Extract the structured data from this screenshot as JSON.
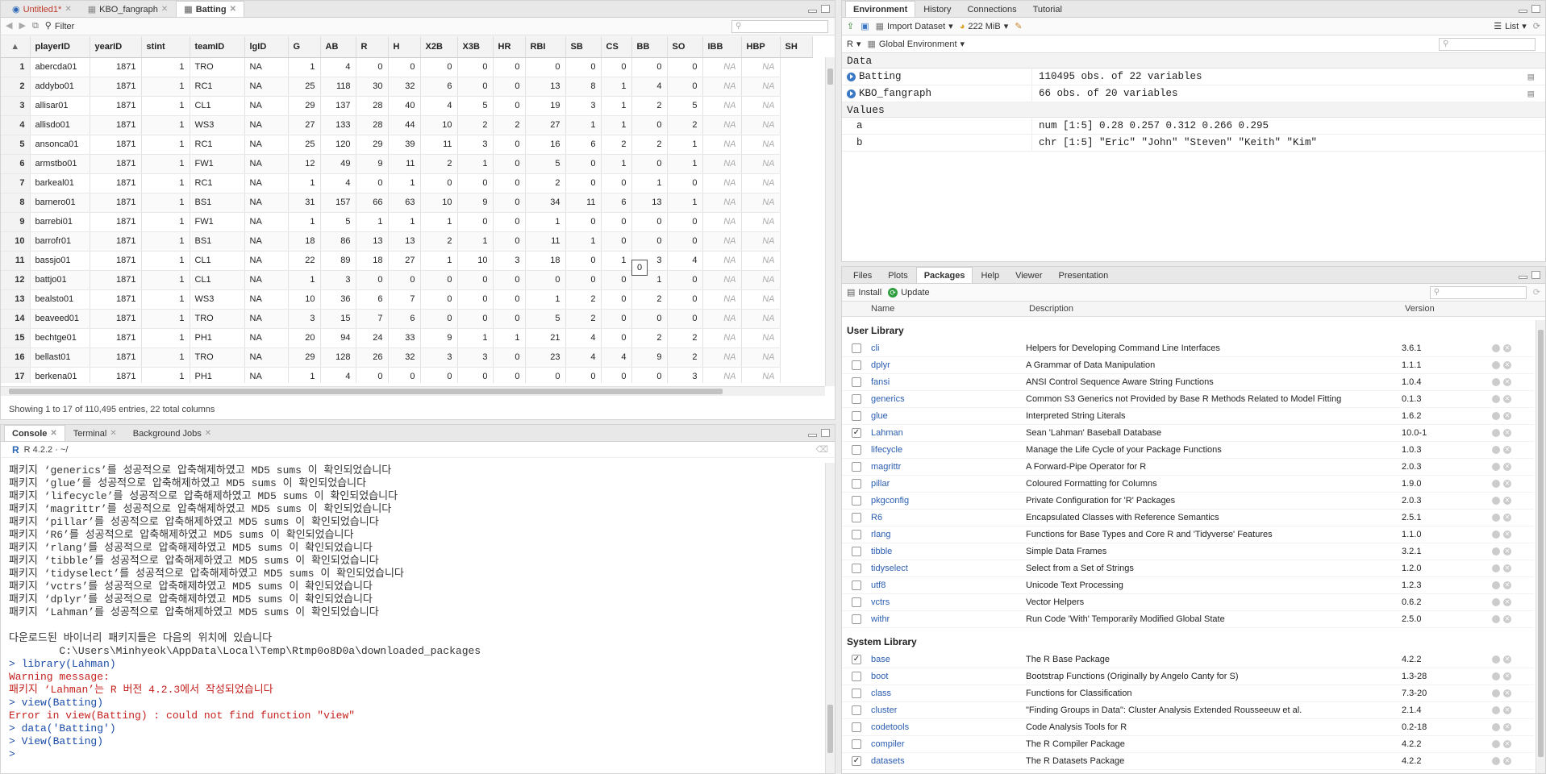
{
  "source_pane": {
    "tabs": [
      {
        "label": "Untitled1*",
        "icon": "r-script-icon"
      },
      {
        "label": "KBO_fangraph",
        "icon": "table-icon"
      },
      {
        "label": "Batting",
        "icon": "table-icon"
      }
    ],
    "filter_label": "Filter",
    "columns": [
      "playerID",
      "yearID",
      "stint",
      "teamID",
      "lgID",
      "G",
      "AB",
      "R",
      "H",
      "X2B",
      "X3B",
      "HR",
      "RBI",
      "SB",
      "CS",
      "BB",
      "SO",
      "IBB",
      "HBP",
      "SH"
    ],
    "rows": [
      [
        "1",
        "abercda01",
        "1871",
        "1",
        "TRO",
        "NA",
        "1",
        "4",
        "0",
        "0",
        "0",
        "0",
        "0",
        "0",
        "0",
        "0",
        "0",
        "0",
        "NA",
        "NA"
      ],
      [
        "2",
        "addybo01",
        "1871",
        "1",
        "RC1",
        "NA",
        "25",
        "118",
        "30",
        "32",
        "6",
        "0",
        "0",
        "13",
        "8",
        "1",
        "4",
        "0",
        "NA",
        "NA"
      ],
      [
        "3",
        "allisar01",
        "1871",
        "1",
        "CL1",
        "NA",
        "29",
        "137",
        "28",
        "40",
        "4",
        "5",
        "0",
        "19",
        "3",
        "1",
        "2",
        "5",
        "NA",
        "NA"
      ],
      [
        "4",
        "allisdo01",
        "1871",
        "1",
        "WS3",
        "NA",
        "27",
        "133",
        "28",
        "44",
        "10",
        "2",
        "2",
        "27",
        "1",
        "1",
        "0",
        "2",
        "NA",
        "NA"
      ],
      [
        "5",
        "ansonca01",
        "1871",
        "1",
        "RC1",
        "NA",
        "25",
        "120",
        "29",
        "39",
        "11",
        "3",
        "0",
        "16",
        "6",
        "2",
        "2",
        "1",
        "NA",
        "NA"
      ],
      [
        "6",
        "armstbo01",
        "1871",
        "1",
        "FW1",
        "NA",
        "12",
        "49",
        "9",
        "11",
        "2",
        "1",
        "0",
        "5",
        "0",
        "1",
        "0",
        "1",
        "NA",
        "NA"
      ],
      [
        "7",
        "barkeal01",
        "1871",
        "1",
        "RC1",
        "NA",
        "1",
        "4",
        "0",
        "1",
        "0",
        "0",
        "0",
        "2",
        "0",
        "0",
        "1",
        "0",
        "NA",
        "NA"
      ],
      [
        "8",
        "barnero01",
        "1871",
        "1",
        "BS1",
        "NA",
        "31",
        "157",
        "66",
        "63",
        "10",
        "9",
        "0",
        "34",
        "11",
        "6",
        "13",
        "1",
        "NA",
        "NA"
      ],
      [
        "9",
        "barrebi01",
        "1871",
        "1",
        "FW1",
        "NA",
        "1",
        "5",
        "1",
        "1",
        "1",
        "0",
        "0",
        "1",
        "0",
        "0",
        "0",
        "0",
        "NA",
        "NA"
      ],
      [
        "10",
        "barrofr01",
        "1871",
        "1",
        "BS1",
        "NA",
        "18",
        "86",
        "13",
        "13",
        "2",
        "1",
        "0",
        "11",
        "1",
        "0",
        "0",
        "0",
        "NA",
        "NA"
      ],
      [
        "11",
        "bassjo01",
        "1871",
        "1",
        "CL1",
        "NA",
        "22",
        "89",
        "18",
        "27",
        "1",
        "10",
        "3",
        "18",
        "0",
        "1",
        "3",
        "4",
        "NA",
        "NA"
      ],
      [
        "12",
        "battjo01",
        "1871",
        "1",
        "CL1",
        "NA",
        "1",
        "3",
        "0",
        "0",
        "0",
        "0",
        "0",
        "0",
        "0",
        "0",
        "1",
        "0",
        "NA",
        "NA"
      ],
      [
        "13",
        "bealsto01",
        "1871",
        "1",
        "WS3",
        "NA",
        "10",
        "36",
        "6",
        "7",
        "0",
        "0",
        "0",
        "1",
        "2",
        "0",
        "2",
        "0",
        "NA",
        "NA"
      ],
      [
        "14",
        "beaveed01",
        "1871",
        "1",
        "TRO",
        "NA",
        "3",
        "15",
        "7",
        "6",
        "0",
        "0",
        "0",
        "5",
        "2",
        "0",
        "0",
        "0",
        "NA",
        "NA"
      ],
      [
        "15",
        "bechtge01",
        "1871",
        "1",
        "PH1",
        "NA",
        "20",
        "94",
        "24",
        "33",
        "9",
        "1",
        "1",
        "21",
        "4",
        "0",
        "2",
        "2",
        "NA",
        "NA"
      ],
      [
        "16",
        "bellast01",
        "1871",
        "1",
        "TRO",
        "NA",
        "29",
        "128",
        "26",
        "32",
        "3",
        "3",
        "0",
        "23",
        "4",
        "4",
        "9",
        "2",
        "NA",
        "NA"
      ],
      [
        "17",
        "berkena01",
        "1871",
        "1",
        "PH1",
        "NA",
        "1",
        "4",
        "0",
        "0",
        "0",
        "0",
        "0",
        "0",
        "0",
        "0",
        "0",
        "3",
        "NA",
        "NA"
      ]
    ],
    "tooltip_value": "0",
    "status": "Showing 1 to 17 of 110,495 entries, 22 total columns"
  },
  "console_pane": {
    "tabs": [
      "Console",
      "Terminal",
      "Background Jobs"
    ],
    "version_path": "R 4.2.2 · ~/",
    "lines": [
      {
        "t": "패키지 ‘generics’를 성공적으로 압축해제하였고 MD5 sums 이 확인되었습니다",
        "c": ""
      },
      {
        "t": "패키지 ‘glue’를 성공적으로 압축해제하였고 MD5 sums 이 확인되었습니다",
        "c": ""
      },
      {
        "t": "패키지 ‘lifecycle’를 성공적으로 압축해제하였고 MD5 sums 이 확인되었습니다",
        "c": ""
      },
      {
        "t": "패키지 ‘magrittr’를 성공적으로 압축해제하였고 MD5 sums 이 확인되었습니다",
        "c": ""
      },
      {
        "t": "패키지 ‘pillar’를 성공적으로 압축해제하였고 MD5 sums 이 확인되었습니다",
        "c": ""
      },
      {
        "t": "패키지 ‘R6’를 성공적으로 압축해제하였고 MD5 sums 이 확인되었습니다",
        "c": ""
      },
      {
        "t": "패키지 ‘rlang’를 성공적으로 압축해제하였고 MD5 sums 이 확인되었습니다",
        "c": ""
      },
      {
        "t": "패키지 ‘tibble’를 성공적으로 압축해제하였고 MD5 sums 이 확인되었습니다",
        "c": ""
      },
      {
        "t": "패키지 ‘tidyselect’를 성공적으로 압축해제하였고 MD5 sums 이 확인되었습니다",
        "c": ""
      },
      {
        "t": "패키지 ‘vctrs’를 성공적으로 압축해제하였고 MD5 sums 이 확인되었습니다",
        "c": ""
      },
      {
        "t": "패키지 ‘dplyr’를 성공적으로 압축해제하였고 MD5 sums 이 확인되었습니다",
        "c": ""
      },
      {
        "t": "패키지 ‘Lahman’를 성공적으로 압축해제하였고 MD5 sums 이 확인되었습니다",
        "c": ""
      },
      {
        "t": " ",
        "c": ""
      },
      {
        "t": "다운로드된 바이너리 패키지들은 다음의 위치에 있습니다",
        "c": ""
      },
      {
        "t": "        C:\\Users\\Minhyeok\\AppData\\Local\\Temp\\Rtmp0o8D0a\\downloaded_packages",
        "c": ""
      },
      {
        "t": "> library(Lahman)",
        "c": "cmd"
      },
      {
        "t": "Warning message:",
        "c": "err"
      },
      {
        "t": "패키지 ‘Lahman’는 R 버전 4.2.3에서 작성되었습니다",
        "c": "err"
      },
      {
        "t": "> view(Batting)",
        "c": "cmd"
      },
      {
        "t": "Error in view(Batting) : could not find function \"view\"",
        "c": "err"
      },
      {
        "t": "> data('Batting')",
        "c": "cmd"
      },
      {
        "t": "> View(Batting)",
        "c": "cmd"
      },
      {
        "t": "> ",
        "c": "cmd"
      }
    ]
  },
  "env_pane": {
    "tabs": [
      "Environment",
      "History",
      "Connections",
      "Tutorial"
    ],
    "import_label": "Import Dataset",
    "memory": "222 MiB",
    "view_mode": "List",
    "lang": "R",
    "scope": "Global Environment",
    "data_header": "Data",
    "values_header": "Values",
    "data_items": [
      {
        "name": "Batting",
        "value": "110495 obs. of 22 variables"
      },
      {
        "name": "KBO_fangraph",
        "value": "66 obs. of 20 variables"
      }
    ],
    "value_items": [
      {
        "name": "a",
        "value": "num [1:5] 0.28 0.257 0.312 0.266 0.295"
      },
      {
        "name": "b",
        "value": "chr [1:5] \"Eric\" \"John\" \"Steven\" \"Keith\" \"Kim\""
      }
    ]
  },
  "files_pane": {
    "tabs": [
      "Files",
      "Plots",
      "Packages",
      "Help",
      "Viewer",
      "Presentation"
    ],
    "install_label": "Install",
    "update_label": "Update",
    "col_name": "Name",
    "col_desc": "Description",
    "col_version": "Version",
    "user_library": "User Library",
    "system_library": "System Library",
    "user_packages": [
      {
        "n": "cli",
        "d": "Helpers for Developing Command Line Interfaces",
        "v": "3.6.1",
        "c": false
      },
      {
        "n": "dplyr",
        "d": "A Grammar of Data Manipulation",
        "v": "1.1.1",
        "c": false
      },
      {
        "n": "fansi",
        "d": "ANSI Control Sequence Aware String Functions",
        "v": "1.0.4",
        "c": false
      },
      {
        "n": "generics",
        "d": "Common S3 Generics not Provided by Base R Methods Related to Model Fitting",
        "v": "0.1.3",
        "c": false
      },
      {
        "n": "glue",
        "d": "Interpreted String Literals",
        "v": "1.6.2",
        "c": false
      },
      {
        "n": "Lahman",
        "d": "Sean 'Lahman' Baseball Database",
        "v": "10.0-1",
        "c": true
      },
      {
        "n": "lifecycle",
        "d": "Manage the Life Cycle of your Package Functions",
        "v": "1.0.3",
        "c": false
      },
      {
        "n": "magrittr",
        "d": "A Forward-Pipe Operator for R",
        "v": "2.0.3",
        "c": false
      },
      {
        "n": "pillar",
        "d": "Coloured Formatting for Columns",
        "v": "1.9.0",
        "c": false
      },
      {
        "n": "pkgconfig",
        "d": "Private Configuration for 'R' Packages",
        "v": "2.0.3",
        "c": false
      },
      {
        "n": "R6",
        "d": "Encapsulated Classes with Reference Semantics",
        "v": "2.5.1",
        "c": false
      },
      {
        "n": "rlang",
        "d": "Functions for Base Types and Core R and 'Tidyverse' Features",
        "v": "1.1.0",
        "c": false
      },
      {
        "n": "tibble",
        "d": "Simple Data Frames",
        "v": "3.2.1",
        "c": false
      },
      {
        "n": "tidyselect",
        "d": "Select from a Set of Strings",
        "v": "1.2.0",
        "c": false
      },
      {
        "n": "utf8",
        "d": "Unicode Text Processing",
        "v": "1.2.3",
        "c": false
      },
      {
        "n": "vctrs",
        "d": "Vector Helpers",
        "v": "0.6.2",
        "c": false
      },
      {
        "n": "withr",
        "d": "Run Code 'With' Temporarily Modified Global State",
        "v": "2.5.0",
        "c": false
      }
    ],
    "system_packages": [
      {
        "n": "base",
        "d": "The R Base Package",
        "v": "4.2.2",
        "c": true
      },
      {
        "n": "boot",
        "d": "Bootstrap Functions (Originally by Angelo Canty for S)",
        "v": "1.3-28",
        "c": false
      },
      {
        "n": "class",
        "d": "Functions for Classification",
        "v": "7.3-20",
        "c": false
      },
      {
        "n": "cluster",
        "d": "\"Finding Groups in Data\": Cluster Analysis Extended Rousseeuw et al.",
        "v": "2.1.4",
        "c": false
      },
      {
        "n": "codetools",
        "d": "Code Analysis Tools for R",
        "v": "0.2-18",
        "c": false
      },
      {
        "n": "compiler",
        "d": "The R Compiler Package",
        "v": "4.2.2",
        "c": false
      },
      {
        "n": "datasets",
        "d": "The R Datasets Package",
        "v": "4.2.2",
        "c": true
      }
    ]
  }
}
